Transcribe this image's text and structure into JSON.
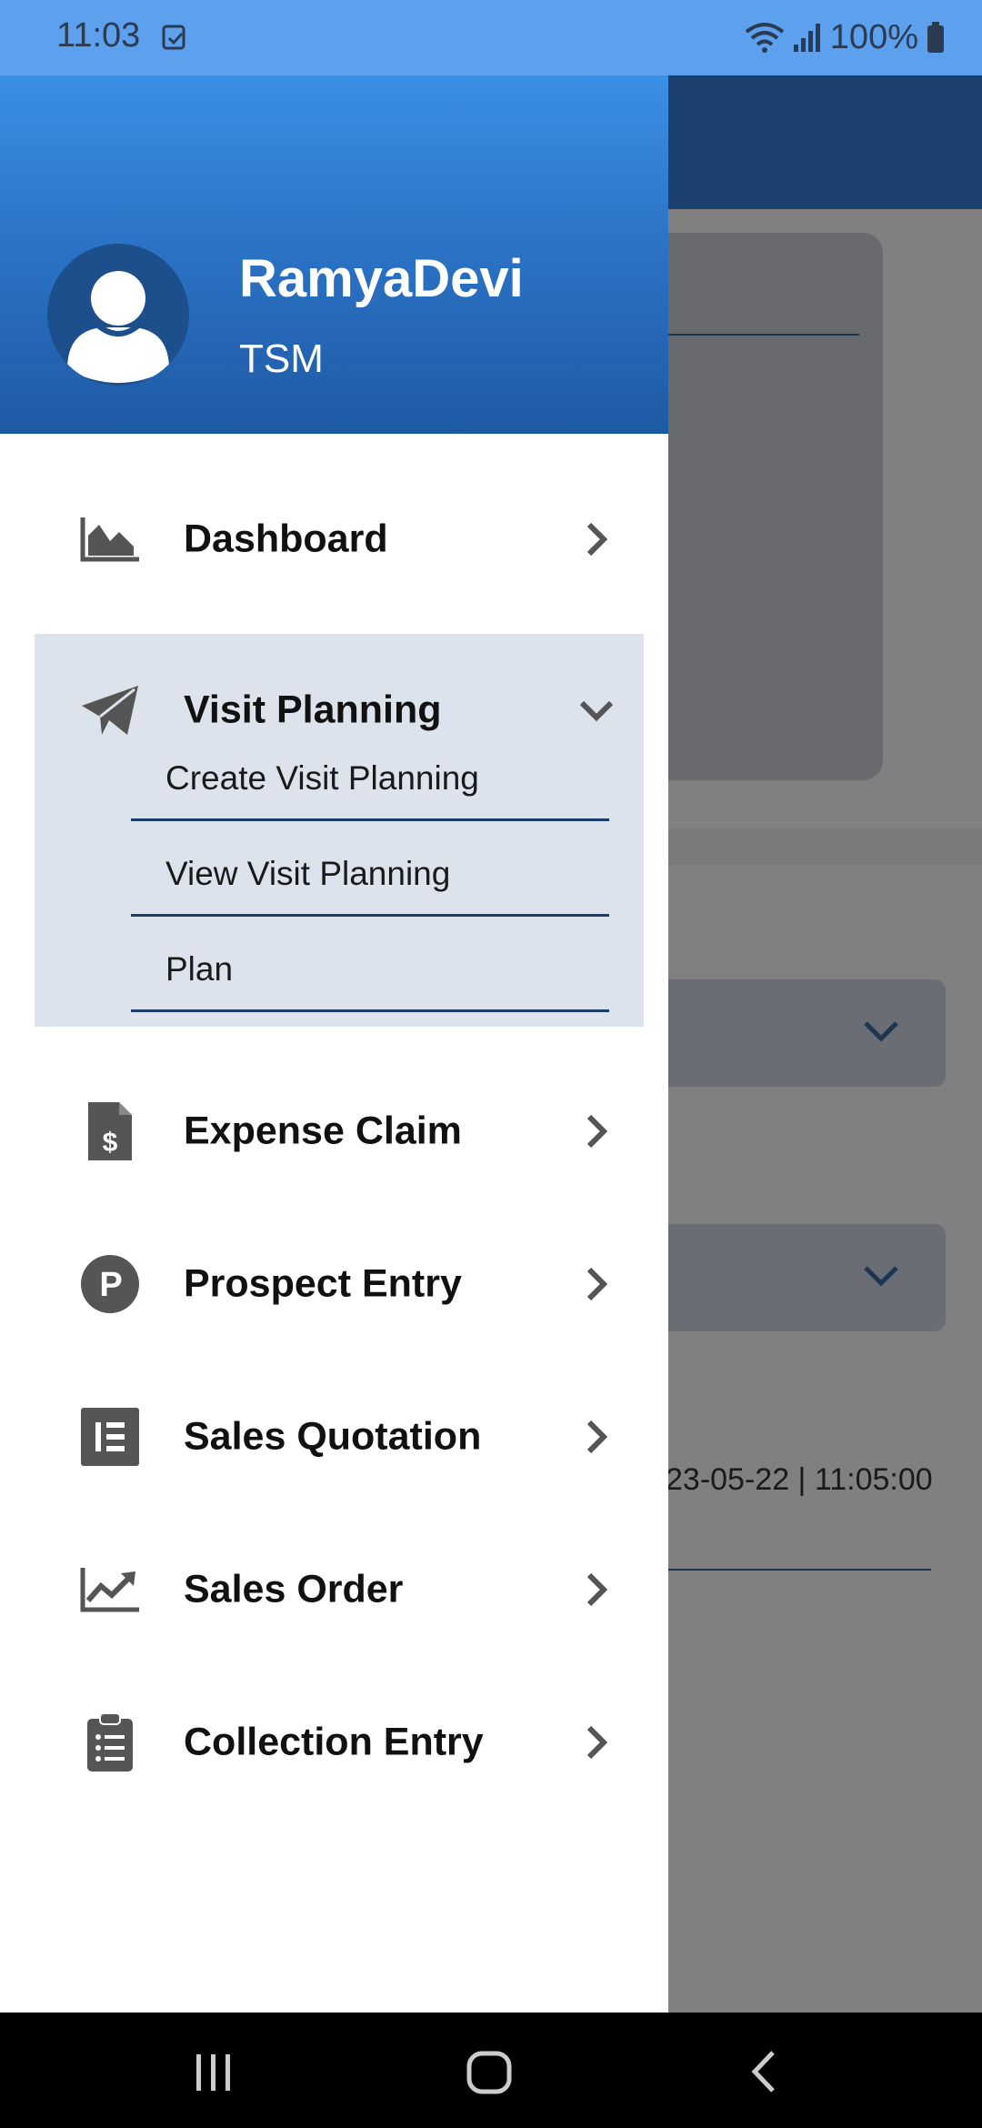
{
  "status_bar": {
    "time": "11:03",
    "battery": "100%",
    "icons": [
      "note-icon",
      "wifi-icon",
      "signal-icon",
      "battery-icon"
    ]
  },
  "user": {
    "name": "RamyaDevi",
    "role": "TSM"
  },
  "menu": {
    "dashboard": "Dashboard",
    "visit_planning": "Visit Planning",
    "visit_sub": {
      "create": "Create Visit Planning",
      "view": "View Visit Planning",
      "plan": "Plan"
    },
    "expense_claim": "Expense Claim",
    "prospect_entry": "Prospect Entry",
    "sales_quotation": "Sales Quotation",
    "sales_order": "Sales Order",
    "collection_entry": "Collection Entry"
  },
  "background": {
    "datetime_fragment": "23-05-22 | 11:05:00"
  },
  "colors": {
    "status_bar": "#5da0ee",
    "drawer_header_top": "#3b8fe6",
    "drawer_header_bottom": "#1e5aa4",
    "expanded_group_bg": "#dde3ec",
    "underline": "#1c3e6a"
  }
}
